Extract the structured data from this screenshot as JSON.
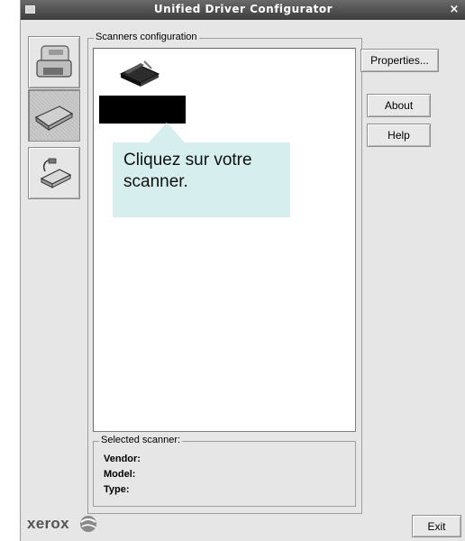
{
  "window": {
    "title": "Unified Driver Configurator",
    "close_symbol": "×"
  },
  "sidebar": {
    "items": [
      {
        "name": "printers",
        "icon": "printer-icon",
        "active": false
      },
      {
        "name": "scanners",
        "icon": "scanner-icon",
        "active": true
      },
      {
        "name": "ports",
        "icon": "port-icon",
        "active": false
      }
    ]
  },
  "scanners_group": {
    "label": "Scanners configuration",
    "tooltip": "Cliquez sur votre scanner."
  },
  "selected_scanner": {
    "label": "Selected scanner:",
    "vendor_label": "Vendor:",
    "model_label": "Model:",
    "type_label": "Type:"
  },
  "buttons": {
    "properties": "Properties...",
    "about": "About",
    "help": "Help",
    "exit": "Exit"
  },
  "brand": {
    "name": "xerox"
  },
  "colors": {
    "titlebar": "#4a4a4a",
    "window_bg": "#e6e6e6",
    "tooltip_bg": "#d6eeee",
    "selection": "#000000"
  }
}
